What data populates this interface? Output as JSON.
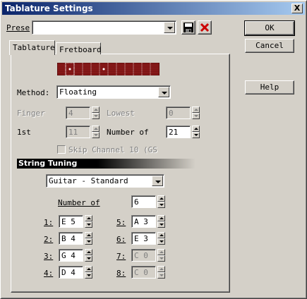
{
  "window": {
    "title": "Tablature Settings",
    "close_glyph": "X"
  },
  "preset": {
    "label": "Prese",
    "value": ""
  },
  "buttons": {
    "ok": "OK",
    "cancel": "Cancel",
    "help": "Help"
  },
  "tabs": [
    {
      "label": "Tablature"
    },
    {
      "label": "Fretboard"
    }
  ],
  "tablature": {
    "method_label": "Method:",
    "method_value": "Floating",
    "finger_label": "Finger",
    "finger_value": "4",
    "lowest_label": "Lowest",
    "lowest_value": "0",
    "first_label": "1st",
    "first_value": "11",
    "number_of_label": "Number of",
    "number_of_value": "21",
    "skip_label": "Skip Channel 10 (GS"
  },
  "string_tuning": {
    "section_title": "String Tuning",
    "preset_value": "Guitar - Standard",
    "number_label": "Number of",
    "number_value": "6",
    "strings": [
      {
        "label": "1:",
        "value": "E 5",
        "enabled": true
      },
      {
        "label": "2:",
        "value": "B 4",
        "enabled": true
      },
      {
        "label": "3:",
        "value": "G 4",
        "enabled": true
      },
      {
        "label": "4:",
        "value": "D 4",
        "enabled": true
      },
      {
        "label": "5:",
        "value": "A 3",
        "enabled": true
      },
      {
        "label": "6:",
        "value": "E 3",
        "enabled": true
      },
      {
        "label": "7:",
        "value": "C 0",
        "enabled": false
      },
      {
        "label": "8:",
        "value": "C 0",
        "enabled": false
      }
    ]
  },
  "colors": {
    "title_start": "#0a246a",
    "title_end": "#a6caf0",
    "fretboard": "#8b1a1a",
    "delete_icon": "#cc0000"
  },
  "icons": {
    "save": "save-disk-icon",
    "delete": "delete-x-icon",
    "dropdown": "chevron-down-icon"
  }
}
